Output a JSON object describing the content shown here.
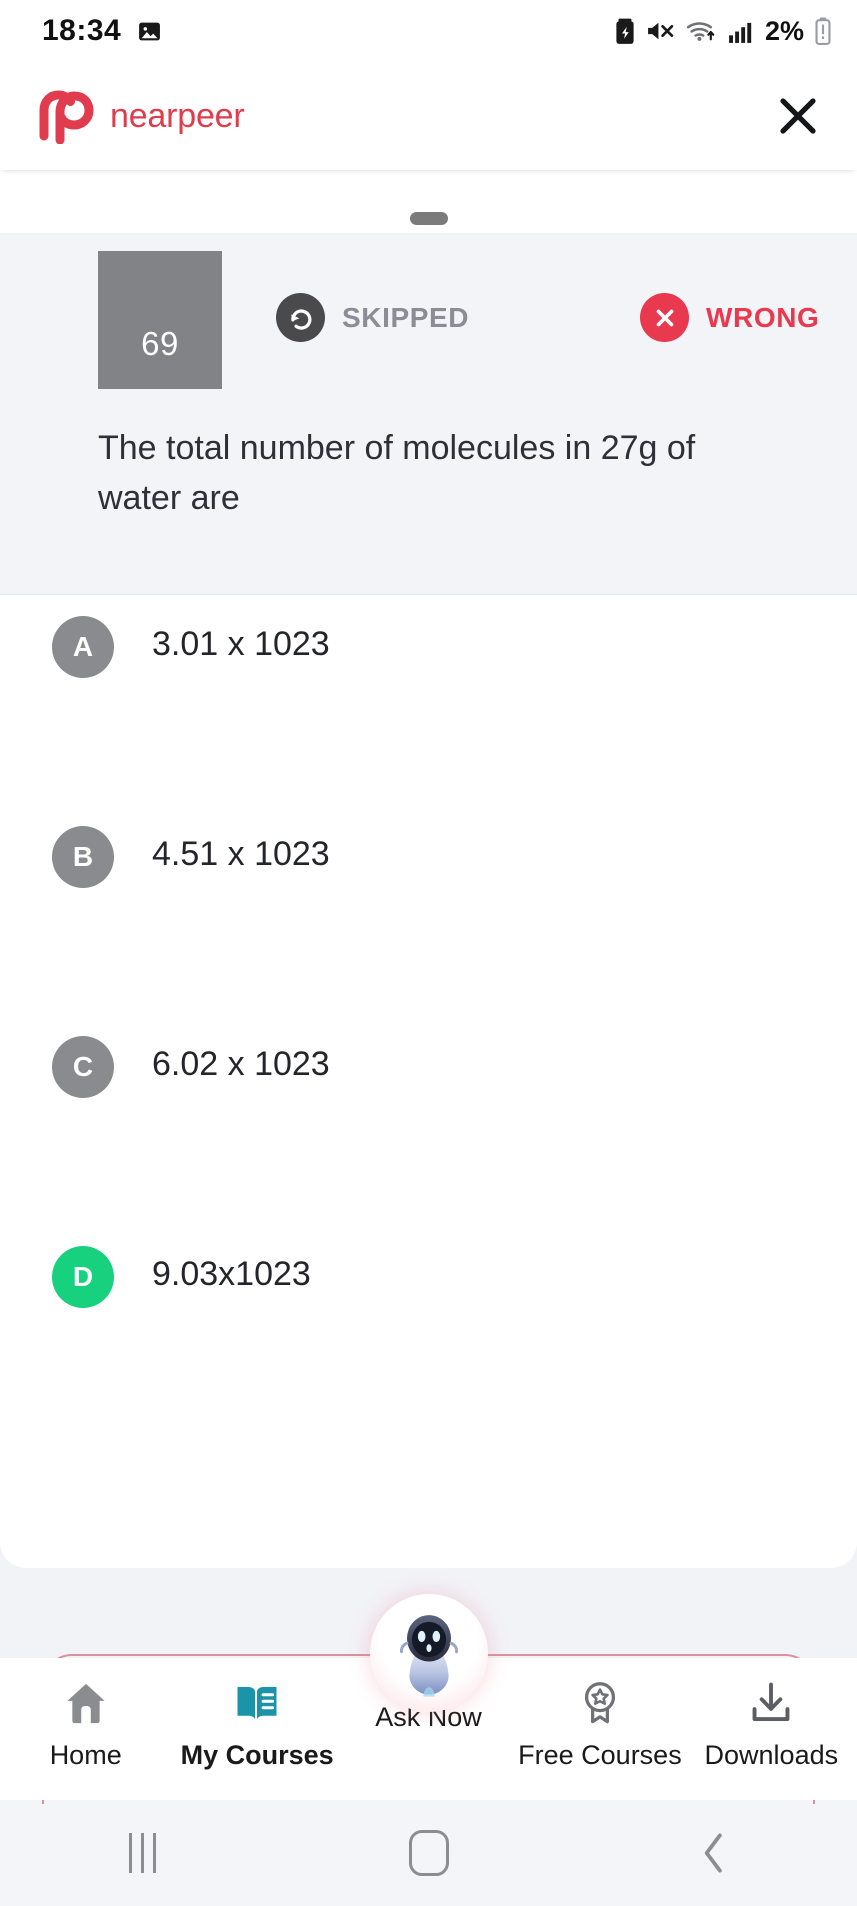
{
  "status_bar": {
    "time": "18:34",
    "battery_percent": "2%",
    "icons": [
      "image-icon",
      "battery-saver-icon",
      "mute-icon",
      "wifi-icon",
      "signal-icon",
      "battery-icon"
    ]
  },
  "app_bar": {
    "brand_name": "nearpeer",
    "brand_color": "#e13b4e",
    "close_label": "close-icon"
  },
  "question_panel": {
    "number": "69",
    "statuses": [
      {
        "key": "skipped",
        "label": "SKIPPED",
        "color": "#8b8d96",
        "icon": "skip-arrow-icon"
      },
      {
        "key": "wrong",
        "label": "WRONG",
        "color": "#e8394f",
        "icon": "cross-circle-icon"
      }
    ],
    "question_text": "The total number of molecules in 27g of water are"
  },
  "options": [
    {
      "letter": "A",
      "text": "3.01 x 1023",
      "state": "neutral",
      "color": "#8a8b8e"
    },
    {
      "letter": "B",
      "text": "4.51 x 1023",
      "state": "neutral",
      "color": "#8a8b8e"
    },
    {
      "letter": "C",
      "text": "6.02 x 1023",
      "state": "neutral",
      "color": "#8a8b8e"
    },
    {
      "letter": "D",
      "text": "9.03x1023",
      "state": "correct",
      "color": "#17d17e"
    }
  ],
  "bottom_nav": {
    "items": [
      {
        "label": "Home",
        "icon": "home-icon",
        "active": false
      },
      {
        "label": "My Courses",
        "icon": "book-icon",
        "active": true
      },
      {
        "label": "Ask Now",
        "icon": "robot-avatar-icon",
        "active": false
      },
      {
        "label": "Free Courses",
        "icon": "badge-icon",
        "active": false
      },
      {
        "label": "Downloads",
        "icon": "download-icon",
        "active": false
      }
    ],
    "active_color": "#1b94a8",
    "border_color": "#d9929d"
  },
  "system_nav": {
    "recents": "recents-icon",
    "home": "home-square-icon",
    "back": "back-chevron-icon"
  }
}
